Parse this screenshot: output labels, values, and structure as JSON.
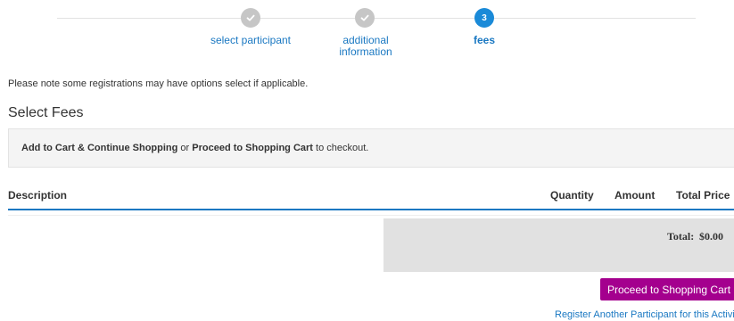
{
  "stepper": {
    "steps": [
      {
        "number": "",
        "label": "select participant",
        "state": "done",
        "icon": "check-icon"
      },
      {
        "number": "",
        "label": "additional information",
        "label_line1": "additional",
        "label_line2": "information",
        "state": "done",
        "icon": "check-icon"
      },
      {
        "number": "3",
        "label": "fees",
        "state": "active"
      }
    ]
  },
  "note": "Please note some registrations may have options select if applicable.",
  "section_title": "Select Fees",
  "info": {
    "link1": "Add to Cart & Continue Shopping",
    "mid": " or ",
    "link2": "Proceed to Shopping Cart",
    "suffix": " to checkout."
  },
  "table": {
    "headers": {
      "description": "Description",
      "quantity": "Quantity",
      "amount": "Amount",
      "total_price": "Total Price"
    }
  },
  "total": {
    "label": "Total:",
    "value": "$0.00"
  },
  "actions": {
    "proceed_label": "Proceed to Shopping Cart",
    "register_another_label": "Register Another Participant for this Activity"
  },
  "colors": {
    "accent": "#1a78c2",
    "active_step": "#1a8ad8",
    "button": "#a4008e",
    "done_step": "#c6c6c6"
  }
}
